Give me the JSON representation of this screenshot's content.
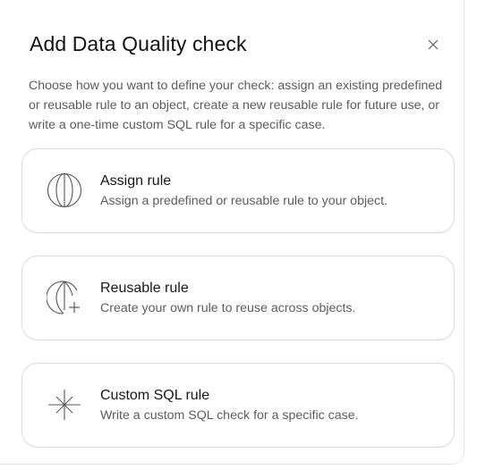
{
  "dialog": {
    "title": "Add Data Quality check",
    "close_icon": "close-icon",
    "description": "Choose how you want to define your check: assign an existing predefined or reusable rule to an object, create a new reusable rule for future use, or write a one-time custom SQL rule for a specific case."
  },
  "options": [
    {
      "icon": "globe-icon",
      "title": "Assign rule",
      "description": "Assign a predefined or reusable rule to your object."
    },
    {
      "icon": "globe-plus-icon",
      "title": "Reusable rule",
      "description": "Create your own rule to reuse across objects."
    },
    {
      "icon": "sparkle-icon",
      "title": "Custom SQL rule",
      "description": "Write a custom SQL check for a specific case."
    }
  ],
  "colors": {
    "text_primary": "#121216",
    "text_secondary": "#5b5b64",
    "card_border": "#d9d9df",
    "icon_stroke": "#55555e"
  }
}
